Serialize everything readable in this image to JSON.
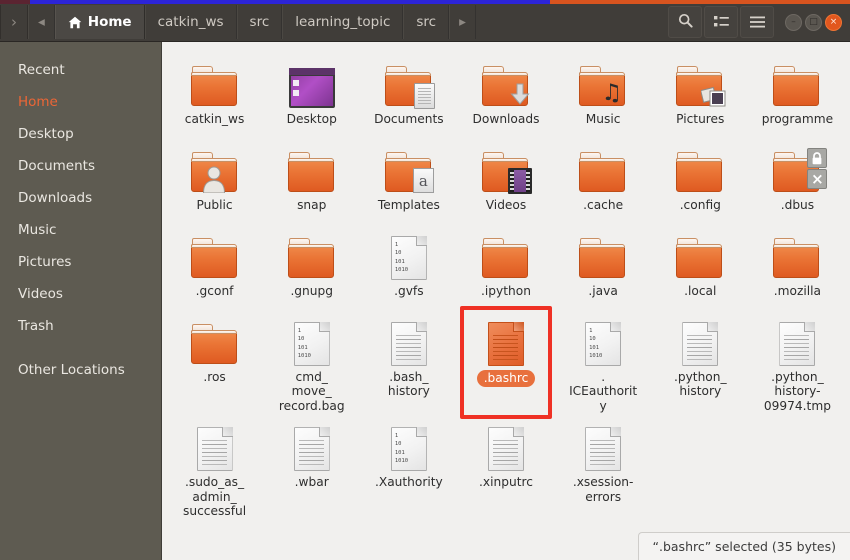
{
  "window": {
    "title": "Home",
    "controls": {
      "minimize": "–",
      "maximize": "□",
      "close": "×"
    }
  },
  "header": {
    "nav_forward": "›",
    "nav_back": "◂",
    "breadcrumb_overflow": "▸",
    "breadcrumbs": [
      {
        "label": "Home",
        "icon": "home-icon",
        "active": true
      },
      {
        "label": "catkin_ws",
        "active": false
      },
      {
        "label": "src",
        "active": false
      },
      {
        "label": "learning_topic",
        "active": false
      },
      {
        "label": "src",
        "active": false
      }
    ],
    "tools": [
      {
        "name": "search-icon",
        "label": "Search"
      },
      {
        "name": "view-list-icon",
        "label": "View options"
      },
      {
        "name": "hamburger-menu-icon",
        "label": "Menu"
      }
    ]
  },
  "sidebar": {
    "items": [
      {
        "label": "Recent",
        "selected": false
      },
      {
        "label": "Home",
        "selected": true
      },
      {
        "label": "Desktop",
        "selected": false
      },
      {
        "label": "Documents",
        "selected": false
      },
      {
        "label": "Downloads",
        "selected": false
      },
      {
        "label": "Music",
        "selected": false
      },
      {
        "label": "Pictures",
        "selected": false
      },
      {
        "label": "Videos",
        "selected": false
      },
      {
        "label": "Trash",
        "selected": false
      },
      {
        "label": "Other Locations",
        "selected": false
      }
    ]
  },
  "files": [
    {
      "label": "catkin_ws",
      "icon": "folder",
      "emblem": "none",
      "selected": false
    },
    {
      "label": "Desktop",
      "icon": "folder-desktop",
      "emblem": "none",
      "selected": false
    },
    {
      "label": "Documents",
      "icon": "folder",
      "emblem": "doc",
      "selected": false
    },
    {
      "label": "Downloads",
      "icon": "folder",
      "emblem": "download",
      "selected": false
    },
    {
      "label": "Music",
      "icon": "folder",
      "emblem": "music",
      "selected": false
    },
    {
      "label": "Pictures",
      "icon": "folder",
      "emblem": "photo",
      "selected": false
    },
    {
      "label": "programme",
      "icon": "folder",
      "emblem": "none",
      "selected": false
    },
    {
      "label": "Public",
      "icon": "folder",
      "emblem": "person",
      "selected": false
    },
    {
      "label": "snap",
      "icon": "folder",
      "emblem": "none",
      "selected": false
    },
    {
      "label": "Templates",
      "icon": "folder",
      "emblem": "template",
      "selected": false
    },
    {
      "label": "Videos",
      "icon": "folder",
      "emblem": "film",
      "selected": false
    },
    {
      "label": ".cache",
      "icon": "folder",
      "emblem": "none",
      "selected": false
    },
    {
      "label": ".config",
      "icon": "folder",
      "emblem": "none",
      "selected": false
    },
    {
      "label": ".dbus",
      "icon": "folder",
      "emblem": "lock-x",
      "selected": false
    },
    {
      "label": ".gconf",
      "icon": "folder",
      "emblem": "none",
      "selected": false
    },
    {
      "label": ".gnupg",
      "icon": "folder",
      "emblem": "none",
      "selected": false
    },
    {
      "label": ".gvfs",
      "icon": "binary-doc",
      "emblem": "none",
      "selected": false
    },
    {
      "label": ".ipython",
      "icon": "folder",
      "emblem": "none",
      "selected": false
    },
    {
      "label": ".java",
      "icon": "folder",
      "emblem": "none",
      "selected": false
    },
    {
      "label": ".local",
      "icon": "folder",
      "emblem": "none",
      "selected": false
    },
    {
      "label": ".mozilla",
      "icon": "folder",
      "emblem": "none",
      "selected": false
    },
    {
      "label": ".ros",
      "icon": "folder",
      "emblem": "none",
      "selected": false
    },
    {
      "label": "cmd_\nmove_\nrecord.bag",
      "icon": "binary-doc",
      "emblem": "none",
      "selected": false
    },
    {
      "label": ".bash_\nhistory",
      "icon": "doc",
      "emblem": "none",
      "selected": false
    },
    {
      "label": ".bashrc",
      "icon": "doc-selected",
      "emblem": "none",
      "selected": true
    },
    {
      "label": ".\nICEauthorit\ny",
      "icon": "binary-doc",
      "emblem": "none",
      "selected": false
    },
    {
      "label": ".python_\nhistory",
      "icon": "doc",
      "emblem": "none",
      "selected": false
    },
    {
      "label": ".python_\nhistory-\n09974.tmp",
      "icon": "doc",
      "emblem": "none",
      "selected": false
    },
    {
      "label": ".sudo_as_\nadmin_\nsuccessful",
      "icon": "doc",
      "emblem": "none",
      "selected": false
    },
    {
      "label": ".wbar",
      "icon": "doc",
      "emblem": "none",
      "selected": false
    },
    {
      "label": ".Xauthority",
      "icon": "binary-doc",
      "emblem": "none",
      "selected": false
    },
    {
      "label": ".xinputrc",
      "icon": "doc",
      "emblem": "none",
      "selected": false
    },
    {
      "label": ".xsession-\nerrors",
      "icon": "doc",
      "emblem": "none",
      "selected": false
    }
  ],
  "binary_doc_bits": "1\n10\n101\n1010",
  "statusbar": {
    "text": "“.bashrc” selected  (35 bytes)"
  },
  "annotation": {
    "color": "#ef3124",
    "target": ".bashrc"
  },
  "colors": {
    "header_bg": "#403d39",
    "sidebar_bg": "#5e5b51",
    "content_bg": "#f1f0ee",
    "accent_orange": "#ec6636",
    "selection_orange": "#e8703d",
    "annotation_red": "#ef3124"
  }
}
